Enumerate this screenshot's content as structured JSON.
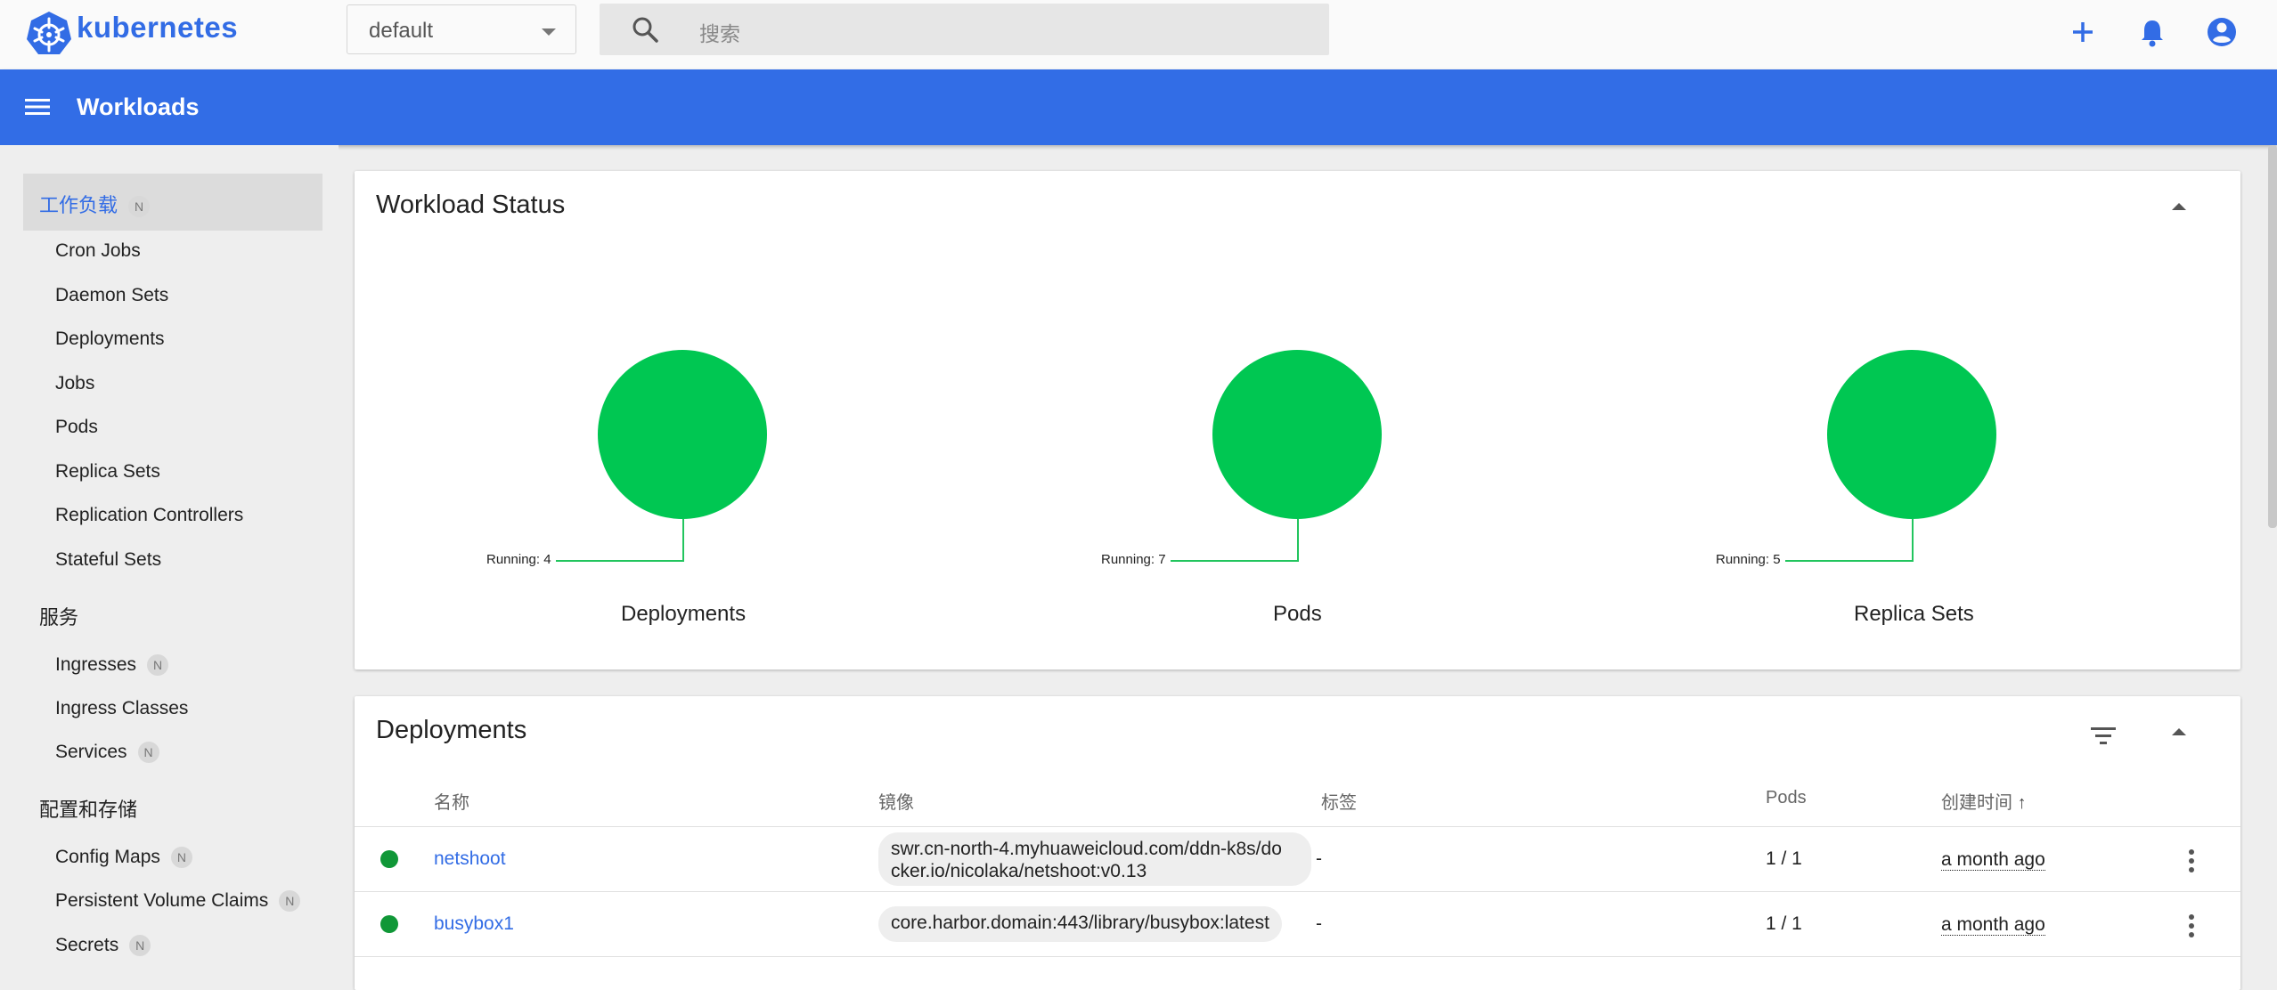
{
  "topbar": {
    "brand": "kubernetes",
    "namespace": "default",
    "search_placeholder": "搜索",
    "icons": [
      "add-icon",
      "notifications-icon",
      "account-icon"
    ]
  },
  "header": {
    "title": "Workloads"
  },
  "sidebar": {
    "active": {
      "label": "工作负载",
      "badge": "N"
    },
    "workloads": [
      "Cron Jobs",
      "Daemon Sets",
      "Deployments",
      "Jobs",
      "Pods",
      "Replica Sets",
      "Replication Controllers",
      "Stateful Sets"
    ],
    "services_heading": "服务",
    "services": [
      {
        "label": "Ingresses",
        "badge": "N"
      },
      {
        "label": "Ingress Classes"
      },
      {
        "label": "Services",
        "badge": "N"
      }
    ],
    "config_heading": "配置和存储",
    "config": [
      {
        "label": "Config Maps",
        "badge": "N"
      },
      {
        "label": "Persistent Volume Claims",
        "badge": "N"
      },
      {
        "label": "Secrets",
        "badge": "N"
      }
    ]
  },
  "workload_status": {
    "title": "Workload Status",
    "charts": [
      {
        "name": "Deployments",
        "running_label": "Running: 4",
        "running": 4
      },
      {
        "name": "Pods",
        "running_label": "Running: 7",
        "running": 7
      },
      {
        "name": "Replica Sets",
        "running_label": "Running: 5",
        "running": 5
      }
    ]
  },
  "deployments": {
    "title": "Deployments",
    "columns": {
      "name": "名称",
      "image": "镜像",
      "labels": "标签",
      "pods": "Pods",
      "created": "创建时间"
    },
    "sort_arrow": "↑",
    "rows": [
      {
        "name": "netshoot",
        "image": "swr.cn-north-4.myhuaweicloud.com/ddn-k8s/docker.io/nicolaka/netshoot:v0.13",
        "image_line1": "swr.cn-north-4.myhuaweicloud.com/ddn-k8s/do",
        "image_line2": "cker.io/nicolaka/netshoot:v0.13",
        "labels": "-",
        "pods": "1 / 1",
        "created": "a month ago",
        "status_color": "#109737"
      },
      {
        "name": "busybox1",
        "image": "core.harbor.domain:443/library/busybox:latest",
        "labels": "-",
        "pods": "1 / 1",
        "created": "a month ago",
        "status_color": "#109737"
      }
    ]
  }
}
